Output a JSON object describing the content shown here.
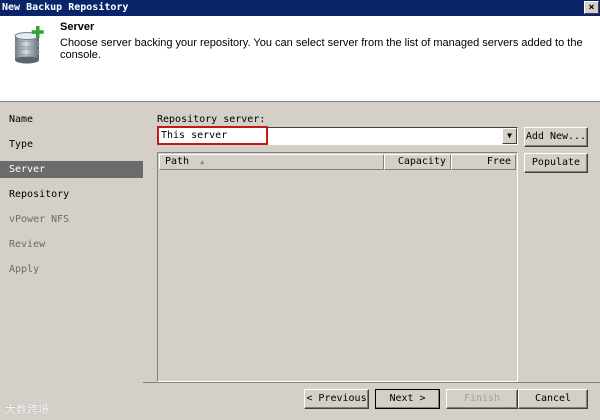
{
  "window": {
    "title": "New Backup Repository",
    "close_label": "×"
  },
  "header": {
    "title": "Server",
    "description": "Choose server backing your repository. You can select server from the list of managed servers added to the console.",
    "icon": "database-add-icon"
  },
  "sidebar": {
    "items": [
      {
        "label": "Name",
        "state": "done"
      },
      {
        "label": "Type",
        "state": "done"
      },
      {
        "label": "Server",
        "state": "active"
      },
      {
        "label": "Repository",
        "state": "done"
      },
      {
        "label": "vPower NFS",
        "state": "pending"
      },
      {
        "label": "Review",
        "state": "pending"
      },
      {
        "label": "Apply",
        "state": "pending"
      }
    ]
  },
  "repository_server": {
    "label": "Repository server:",
    "selected_value": "This server",
    "add_new_label": "Add New...",
    "populate_label": "Populate",
    "highlight_color": "#c41a1a"
  },
  "table": {
    "columns": [
      {
        "label": "Path",
        "sort": "ascending"
      },
      {
        "label": "Capacity"
      },
      {
        "label": "Free"
      }
    ],
    "sort_icon": "▲",
    "rows": []
  },
  "footer": {
    "previous_label": "< Previous",
    "next_label": "Next >",
    "finish_label": "Finish",
    "cancel_label": "Cancel"
  },
  "watermark": "大数跨境",
  "colors": {
    "titlebar": "#0a246a",
    "sidebar_active": "#6b6b6b",
    "face": "#d4d0c8"
  }
}
